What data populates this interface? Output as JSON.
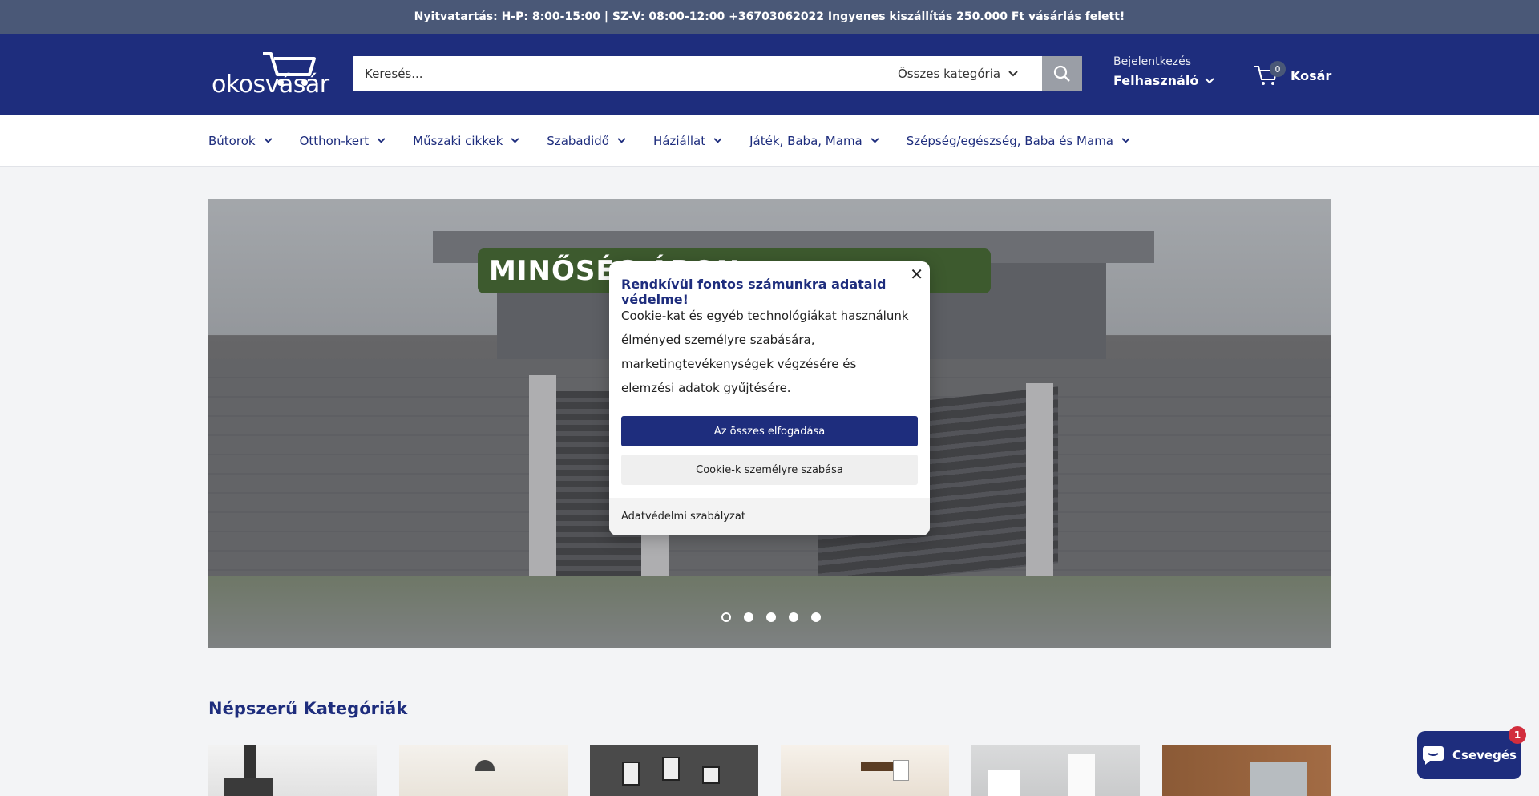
{
  "topbar": {
    "text": "Nyitvatartás: H-P: 8:00-15:00 | SZ-V: 08:00-12:00 +36703062022 Ingyenes kiszállítás 250.000 Ft vásárlás felett!"
  },
  "header": {
    "logo_text": "okosvásár",
    "search_placeholder": "Keresés...",
    "category_select": "Összes kategória",
    "account_small": "Bejelentkezés",
    "account_big": "Felhasználó",
    "cart_count": "0",
    "cart_label": "Kosár"
  },
  "nav": {
    "items": [
      {
        "label": "Bútorok"
      },
      {
        "label": "Otthon-kert"
      },
      {
        "label": "Műszaki cikkek"
      },
      {
        "label": "Szabadidő"
      },
      {
        "label": "Háziállat"
      },
      {
        "label": "Játék, Baba, Mama"
      },
      {
        "label": "Szépség/egészség, Baba és Mama"
      }
    ]
  },
  "hero": {
    "banner_text": "MINŐSÉG                              ÁRON",
    "slide_count": 5,
    "active_slide": 1
  },
  "section": {
    "title": "Népszerű Kategóriák"
  },
  "cookie_modal": {
    "close": "✕",
    "title": "Rendkívül fontos számunkra adataid védelme!",
    "body": "Cookie-kat és egyéb technológiákat használunk élményed személyre szabására, marketingtevékenységek végzésére és elemzési adatok gyűjtésére.",
    "accept_all": "Az összes elfogadása",
    "customize": "Cookie-k személyre szabása",
    "policy_link": "Adatvédelmi szabályzat"
  },
  "chat": {
    "label": "Csevegés",
    "badge": "1"
  },
  "colors": {
    "primary": "#1e2d7d",
    "topbar": "#4a5877",
    "badge": "#d22d3d"
  }
}
